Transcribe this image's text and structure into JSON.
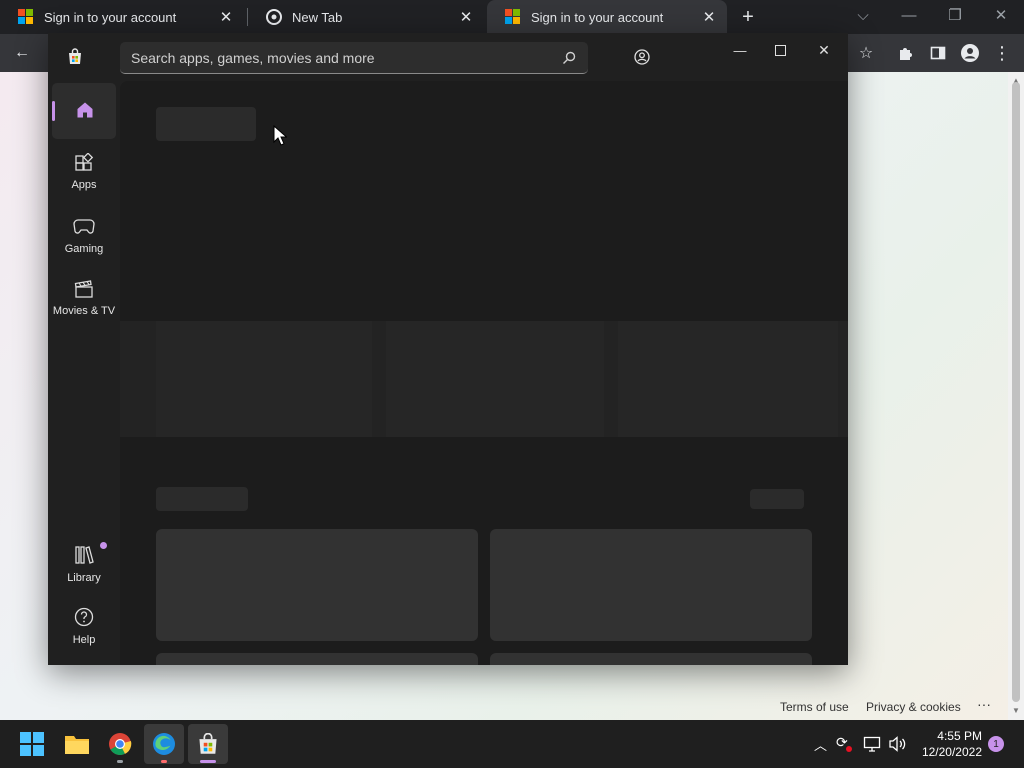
{
  "browser": {
    "tabs": [
      {
        "title": "Sign in to your account",
        "icon": "microsoft-logo"
      },
      {
        "title": "New Tab",
        "icon": "chrome-logo"
      },
      {
        "title": "Sign in to your account",
        "icon": "microsoft-logo"
      }
    ],
    "new_tab_symbol": "+"
  },
  "page": {
    "footer": {
      "terms": "Terms of use",
      "privacy": "Privacy & cookies",
      "more": "···"
    }
  },
  "store": {
    "search_placeholder": "Search apps, games, movies and more",
    "nav": [
      {
        "label": "",
        "icon": "home-icon"
      },
      {
        "label": "Apps",
        "icon": "apps-icon"
      },
      {
        "label": "Gaming",
        "icon": "gamepad-icon"
      },
      {
        "label": "Movies & TV",
        "icon": "clapperboard-icon"
      }
    ],
    "nav_bottom": [
      {
        "label": "Library",
        "icon": "library-icon"
      },
      {
        "label": "Help",
        "icon": "help-icon"
      }
    ]
  },
  "taskbar": {
    "time": "4:55 PM",
    "date": "12/20/2022",
    "notification_count": "1"
  },
  "colors": {
    "accent": "#c792ea",
    "store_bg": "#202020",
    "skeleton": "#2b2b2b"
  }
}
